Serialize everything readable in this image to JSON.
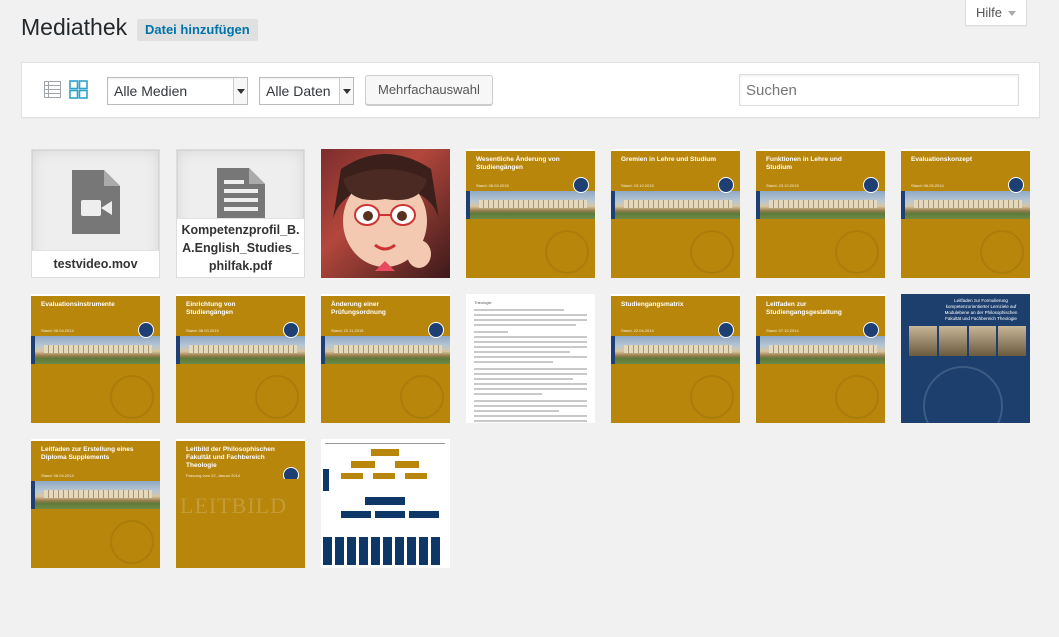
{
  "header": {
    "title": "Mediathek",
    "add_button": "Datei hinzufügen",
    "help_label": "Hilfe"
  },
  "toolbar": {
    "view_list_icon": "list-view-icon",
    "view_grid_icon": "grid-view-icon",
    "media_filter": "Alle Medien",
    "date_filter": "Alle Daten",
    "bulk_select": "Mehrfachauswahl",
    "search_placeholder": "Suchen"
  },
  "items": [
    {
      "type": "file",
      "icon": "video-file-icon",
      "filename": "testvideo.mov"
    },
    {
      "type": "file",
      "icon": "document-file-icon",
      "filename": "Kompetenzprofil_B.A.English_Studies_philfak.pdf"
    },
    {
      "type": "image",
      "subject": "cartoon-avatar"
    },
    {
      "type": "doc",
      "title": "Wesentliche Änderung von Studiengängen",
      "subtitle": "Terminübersicht und Ablauf",
      "date": "Stand: 08.03.2015"
    },
    {
      "type": "doc",
      "title": "Gremien in Lehre und Studium",
      "subtitle": "",
      "date": "Stand: 23.10.2015"
    },
    {
      "type": "doc",
      "title": "Funktionen in Lehre und Studium",
      "subtitle": "",
      "date": "Stand: 23.10.2015"
    },
    {
      "type": "doc",
      "title": "Evaluationskonzept",
      "subtitle": "",
      "date": "Stand: 06.05.2014"
    },
    {
      "type": "doc",
      "title": "Evaluationsinstrumente",
      "subtitle": "",
      "date": "Stand: 06.04.2014"
    },
    {
      "type": "doc",
      "title": "Einrichtung von Studiengängen",
      "subtitle": "Terminübersicht und Ablauf",
      "date": "Stand: 08.03.2015"
    },
    {
      "type": "doc",
      "title": "Änderung einer Prüfungsordnung",
      "subtitle": "Terminübersicht und Ablauf",
      "date": "Stand: 22.11.2015"
    },
    {
      "type": "text",
      "title": "Theologie"
    },
    {
      "type": "doc",
      "title": "Studiengangsmatrix",
      "subtitle": "",
      "date": "Stand: 22.04.2014"
    },
    {
      "type": "doc",
      "title": "Leitfaden zur Studiengangsgestaltung",
      "subtitle": "",
      "date": "Stand: 07.10.2014"
    },
    {
      "type": "blue",
      "title": "Leitfaden zur Formulierung kompetenzorientierter Lernziele auf Modulebene an der Philosophischen Fakultät und Fachbereich Theologie"
    },
    {
      "type": "doc",
      "title": "Leitfaden zur Erstellung eines Diploma Supplements",
      "subtitle": "",
      "date": "Stand: 06.04.2014"
    },
    {
      "type": "leitbild",
      "title": "Leitbild der Philosophischen Fakultät und Fachbereich Theologie",
      "subtitle": "Fassung vom 22. Januar 2014",
      "watermark": "LEITBILD"
    },
    {
      "type": "org",
      "subject": "organization-chart"
    }
  ],
  "colors": {
    "accent": "#0073aa",
    "doc_gold": "#b8860b",
    "doc_blue": "#1d3f73"
  }
}
